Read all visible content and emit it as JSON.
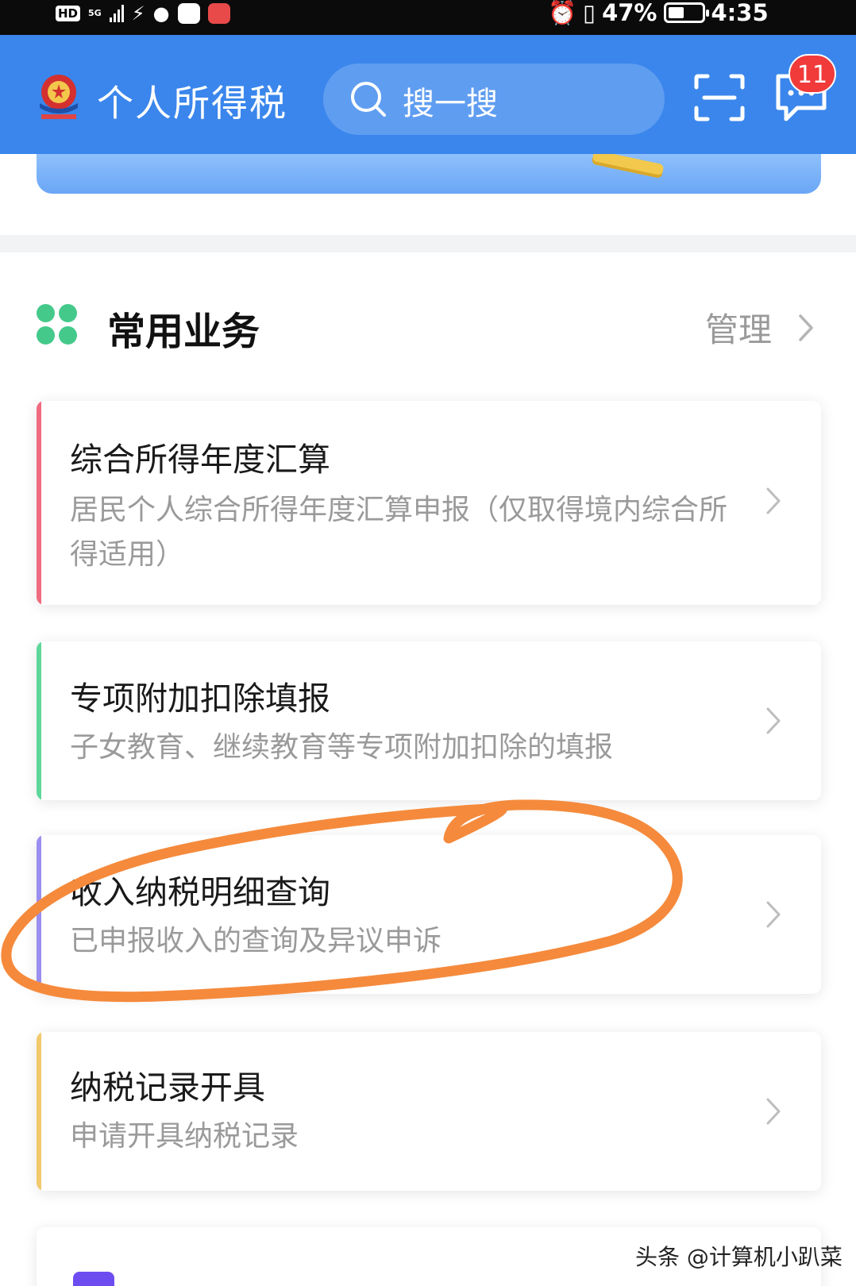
{
  "status_bar": {
    "hd": "HD",
    "network": "5G",
    "battery": "47%",
    "battery_level": 0.47,
    "time": "4:35"
  },
  "header": {
    "title": "个人所得税",
    "search_placeholder": "搜一搜",
    "message_badge": "11"
  },
  "section": {
    "title": "常用业务",
    "manage_label": "管理"
  },
  "services": [
    {
      "title": "综合所得年度汇算",
      "desc": "居民个人综合所得年度汇算申报（仅取得境内综合所得适用）",
      "accent": "#f06b7f"
    },
    {
      "title": "专项附加扣除填报",
      "desc": "子女教育、继续教育等专项附加扣除的填报",
      "accent": "#5ed79a"
    },
    {
      "title": "收入纳税明细查询",
      "desc": "已申报收入的查询及异议申诉",
      "accent": "#9a8ef0"
    },
    {
      "title": "纳税记录开具",
      "desc": "申请开具纳税记录",
      "accent": "#f2c96b"
    }
  ],
  "colors": {
    "header_bg": "#3a86ec",
    "annotation_stroke": "#f58a3c",
    "section_icon": "#44c98a"
  },
  "icons": [
    "app-emblem-icon",
    "search-icon",
    "scan-icon",
    "message-icon",
    "grid-icon",
    "chevron-right-icon"
  ],
  "watermark": "头条 @计算机小趴菜"
}
